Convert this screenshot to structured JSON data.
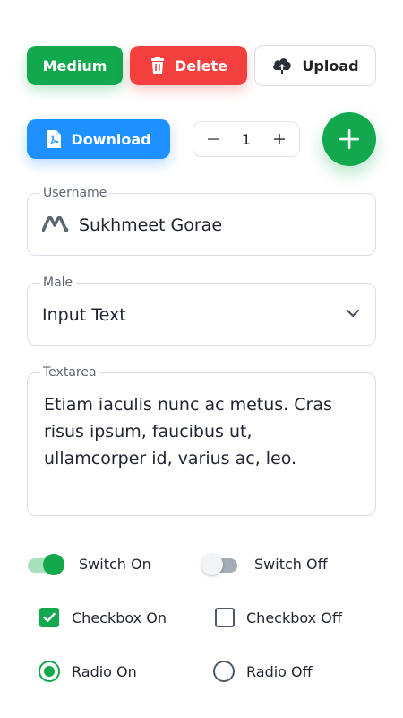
{
  "buttons": {
    "medium_label": "Medium",
    "delete_label": "Delete",
    "upload_label": "Upload",
    "download_label": "Download"
  },
  "icons": {
    "delete": "trash-icon",
    "upload": "cloud-upload-icon",
    "download": "pdf-file-icon",
    "fab": "plus-icon",
    "username": "brand-logo-icon",
    "select": "chevron-down-icon"
  },
  "stepper": {
    "value": "1",
    "decrement": "minus-icon",
    "increment": "plus-icon"
  },
  "form": {
    "username": {
      "label": "Username",
      "value": "Sukhmeet Gorae"
    },
    "select": {
      "label": "Male",
      "value": "Input Text"
    },
    "textarea": {
      "label": "Textarea",
      "value": "Etiam iaculis nunc ac metus. Cras risus ipsum, faucibus ut, ullamcorper id, varius ac, leo."
    }
  },
  "controls": {
    "switch_on_label": "Switch On",
    "switch_off_label": "Switch Off",
    "checkbox_on_label": "Checkbox On",
    "checkbox_off_label": "Checkbox Off",
    "radio_on_label": "Radio On",
    "radio_off_label": "Radio Off"
  },
  "colors": {
    "green": "#11a84e",
    "red": "#f43f3f",
    "blue": "#1e90ff",
    "border": "#d9dde3",
    "label": "#5d6672"
  }
}
